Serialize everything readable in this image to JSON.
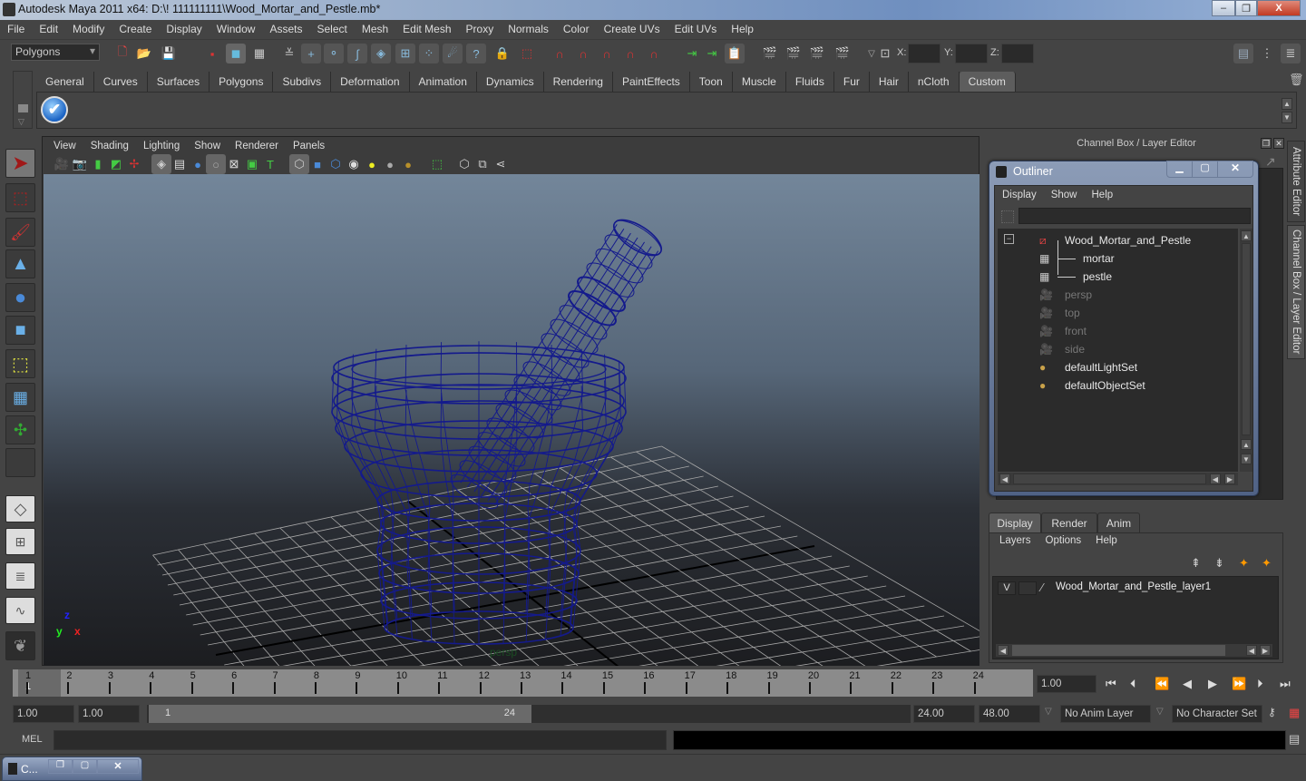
{
  "window": {
    "title": "Autodesk Maya 2011 x64: D:\\! 111111111\\Wood_Mortar_and_Pestle.mb*",
    "controls": {
      "minimize": "–",
      "restore": "❐",
      "close": "X"
    }
  },
  "menubar": [
    "File",
    "Edit",
    "Modify",
    "Create",
    "Display",
    "Window",
    "Assets",
    "Select",
    "Mesh",
    "Edit Mesh",
    "Proxy",
    "Normals",
    "Color",
    "Create UVs",
    "Edit UVs",
    "Help"
  ],
  "statusline": {
    "mode": "Polygons",
    "coords": {
      "x_label": "X:",
      "y_label": "Y:",
      "z_label": "Z:",
      "x": "",
      "y": "",
      "z": ""
    }
  },
  "shelf": {
    "tabs": [
      "General",
      "Curves",
      "Surfaces",
      "Polygons",
      "Subdivs",
      "Deformation",
      "Animation",
      "Dynamics",
      "Rendering",
      "PaintEffects",
      "Toon",
      "Muscle",
      "Fluids",
      "Fur",
      "Hair",
      "nCloth",
      "Custom"
    ],
    "active_tab": "Custom"
  },
  "viewport": {
    "menu": [
      "View",
      "Shading",
      "Lighting",
      "Show",
      "Renderer",
      "Panels"
    ],
    "camera_label": "persp",
    "axis": {
      "x": "x",
      "y": "y",
      "z": "z"
    },
    "wire_color": "#141a8c"
  },
  "channel_box": {
    "title": "Channel Box / Layer Editor"
  },
  "side_tabs": [
    "Attribute Editor",
    "Channel Box / Layer Editor"
  ],
  "outliner": {
    "title": "Outliner",
    "menu": [
      "Display",
      "Show",
      "Help"
    ],
    "filter": "",
    "items": [
      {
        "label": "Wood_Mortar_and_Pestle",
        "kind": "group",
        "dim": false
      },
      {
        "label": "mortar",
        "kind": "mesh",
        "dim": false
      },
      {
        "label": "pestle",
        "kind": "mesh",
        "dim": false
      },
      {
        "label": "persp",
        "kind": "camera",
        "dim": true
      },
      {
        "label": "top",
        "kind": "camera",
        "dim": true
      },
      {
        "label": "front",
        "kind": "camera",
        "dim": true
      },
      {
        "label": "side",
        "kind": "camera",
        "dim": true
      },
      {
        "label": "defaultLightSet",
        "kind": "set",
        "dim": false
      },
      {
        "label": "defaultObjectSet",
        "kind": "set",
        "dim": false
      }
    ]
  },
  "layer_editor": {
    "tabs": [
      "Display",
      "Render",
      "Anim"
    ],
    "active_tab": "Display",
    "menu": [
      "Layers",
      "Options",
      "Help"
    ],
    "layers": [
      {
        "visible": "V",
        "type": "",
        "name": "Wood_Mortar_and_Pestle_layer1"
      }
    ]
  },
  "timeline": {
    "ticks": [
      "1",
      "2",
      "3",
      "4",
      "5",
      "6",
      "7",
      "8",
      "9",
      "10",
      "11",
      "12",
      "13",
      "14",
      "15",
      "16",
      "17",
      "18",
      "19",
      "20",
      "21",
      "22",
      "23",
      "24"
    ],
    "current_frame": "1",
    "current_time_field": "1.00"
  },
  "range": {
    "start_time": "1.00",
    "playback_start": "1.00",
    "range_start_label": "1",
    "range_end_label": "24",
    "playback_end": "24.00",
    "end_time": "48.00",
    "anim_layer": "No Anim Layer",
    "character_set": "No Character Set"
  },
  "command_line": {
    "label": "MEL",
    "input": "",
    "result": ""
  },
  "taskbar": {
    "item_label": "C..."
  }
}
